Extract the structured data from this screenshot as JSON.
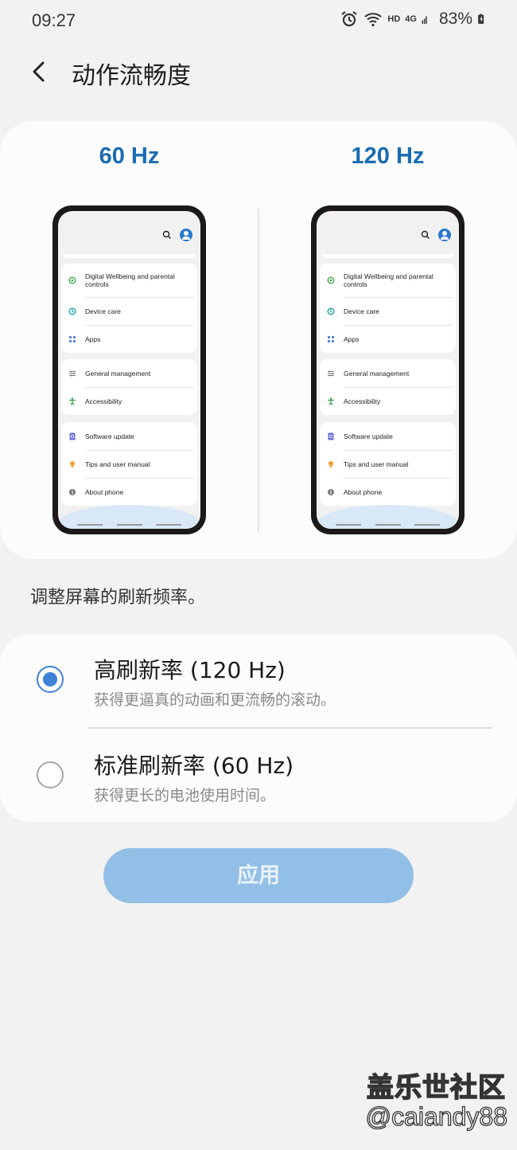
{
  "status_bar": {
    "time": "09:27",
    "network_hd": "HD",
    "network_gen": "4G",
    "battery_percent": "83%",
    "icons": [
      "alarm-icon",
      "wifi-icon",
      "signal-icon",
      "battery-charging-icon"
    ]
  },
  "header": {
    "back_icon": "chevron-left-icon",
    "title": "动作流畅度"
  },
  "preview": {
    "left_label": "60 Hz",
    "right_label": "120 Hz",
    "phone_menu": {
      "group1": [
        "Digital Wellbeing and parental controls",
        "Device care",
        "Apps"
      ],
      "group2": [
        "General management",
        "Accessibility"
      ],
      "group3": [
        "Software update",
        "Tips and user manual",
        "About phone"
      ]
    }
  },
  "description": "调整屏幕的刷新频率。",
  "options": [
    {
      "title": "高刷新率 (120 Hz)",
      "subtitle": "获得更逼真的动画和更流畅的滚动。",
      "selected": true
    },
    {
      "title": "标准刷新率 (60 Hz)",
      "subtitle": "获得更长的电池使用时间。",
      "selected": false
    }
  ],
  "apply_button": "应用",
  "watermark": {
    "line1": "盖乐世社区",
    "line2": "@caiandy88"
  },
  "colors": {
    "accent_blue": "#1a6cb0",
    "radio_blue": "#3e82d6",
    "apply_button_bg": "#92bfe5",
    "background": "#f2f2f2"
  }
}
